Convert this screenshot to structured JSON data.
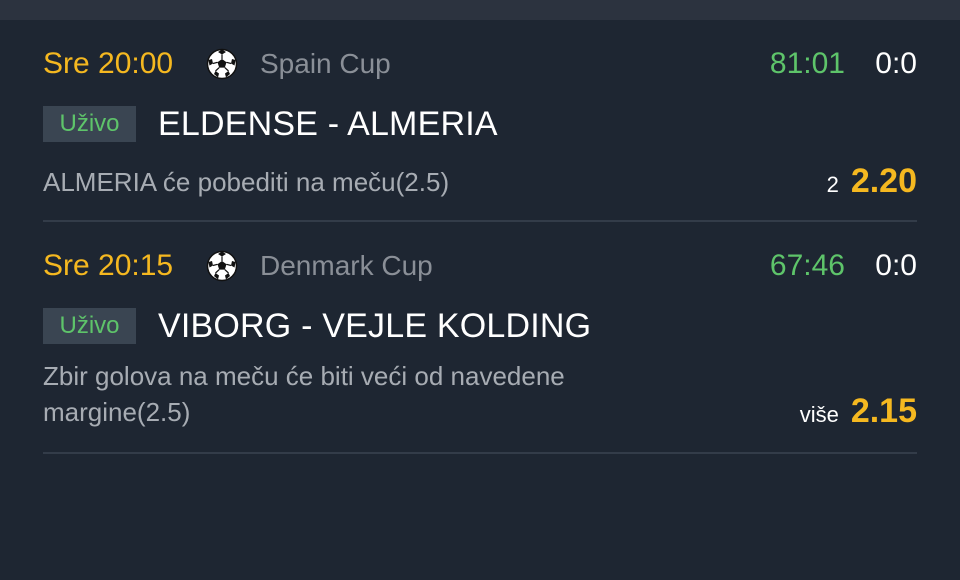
{
  "colors": {
    "background": "#1e2632",
    "time": "#f5b820",
    "live_clock": "#5ec46a",
    "odds": "#f5b820",
    "badge_bg": "#3a4552",
    "divider": "#333c49"
  },
  "matches": [
    {
      "time": "Sre 20:00",
      "icon": "soccer-ball-icon",
      "league": "Spain Cup",
      "clock": "81:01",
      "score": "0:0",
      "badge": "Uživo",
      "teams": "ELDENSE - ALMERIA",
      "bet_description": "ALMERIA će pobediti na meču(2.5)",
      "pick": "2",
      "odds": "2.20"
    },
    {
      "time": "Sre 20:15",
      "icon": "soccer-ball-icon",
      "league": "Denmark Cup",
      "clock": "67:46",
      "score": "0:0",
      "badge": "Uživo",
      "teams": "VIBORG - VEJLE KOLDING",
      "bet_description": "Zbir golova na meču će biti veći od navedene margine(2.5)",
      "pick": "više",
      "odds": "2.15"
    }
  ]
}
